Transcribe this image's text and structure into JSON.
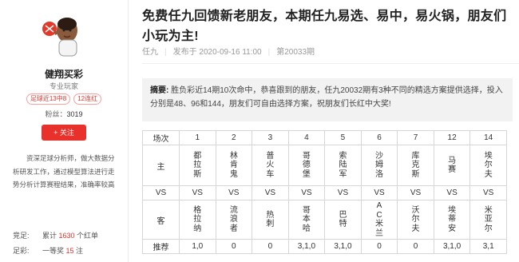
{
  "author": {
    "name": "健翔买彩",
    "role": "专业玩家",
    "badges": [
      "足球近13中8",
      "12连红"
    ],
    "fans_label": "粉丝：",
    "fans_count": "3019",
    "follow_label": "+ 关注",
    "intro": "资深足球分析师，做大数据分析研发工作，通过模型算法进行走势分析计算赛程结果，准确率较高",
    "stats": [
      {
        "label": "竞足:",
        "prefix": "累计 ",
        "value": "1630",
        "suffix": " 个红单"
      },
      {
        "label": "足彩:",
        "prefix": "一等奖 ",
        "value": "15",
        "suffix": " 注"
      }
    ]
  },
  "article": {
    "title": "免费任九回馈新老朋友，本期任九易选、易中，易火锅，朋友们小玩为主!",
    "category": "任九",
    "published": "发布于 2020-09-16 11:00",
    "issue": "第20033期",
    "summary_label": "摘要:",
    "summary": "胜负彩近14期10次命中，恭喜跟到的朋友，任九20032期有3种不同的精选方案提供选择，投入分别是48、96和144，朋友们可自由选择方案，祝朋友们长红中大奖!"
  },
  "table": {
    "labels": {
      "round": "场次",
      "home": "主",
      "vs": "VS",
      "away": "客",
      "rec": "推荐"
    },
    "rounds": [
      "1",
      "2",
      "3",
      "4",
      "5",
      "6",
      "7",
      "12",
      "14"
    ],
    "home": [
      "都拉斯",
      "林肯鬼",
      "普火车",
      "哥德堡",
      "索陆军",
      "沙姆洛",
      "库克斯",
      "马赛",
      "埃尔夫"
    ],
    "away": [
      "格拉纳",
      "流浪者",
      "热刺",
      "哥本哈",
      "巴特",
      "AC米兰",
      "沃尔夫",
      "埃蒂安",
      "米亚尔"
    ],
    "rec": [
      "1,0",
      "0",
      "0",
      "3,1,0",
      "3,1,0",
      "0",
      "0",
      "3,1,0",
      "3,1"
    ]
  }
}
